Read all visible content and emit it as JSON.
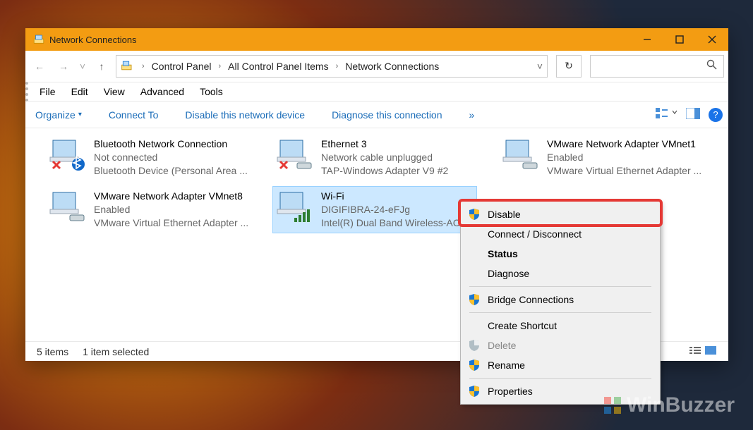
{
  "window": {
    "title": "Network Connections"
  },
  "breadcrumbs": {
    "root": "Control Panel",
    "mid": "All Control Panel Items",
    "leaf": "Network Connections"
  },
  "menubar": {
    "file": "File",
    "edit": "Edit",
    "view": "View",
    "advanced": "Advanced",
    "tools": "Tools"
  },
  "cmdbar": {
    "organize": "Organize",
    "connect_to": "Connect To",
    "disable": "Disable this network device",
    "diagnose": "Diagnose this connection",
    "more": "»"
  },
  "adapters": {
    "bt": {
      "name": "Bluetooth Network Connection",
      "status": "Not connected",
      "desc": "Bluetooth Device (Personal Area ..."
    },
    "eth3": {
      "name": "Ethernet 3",
      "status": "Network cable unplugged",
      "desc": "TAP-Windows Adapter V9 #2"
    },
    "vm1": {
      "name": "VMware Network Adapter VMnet1",
      "status": "Enabled",
      "desc": "VMware Virtual Ethernet Adapter ..."
    },
    "vm8": {
      "name": "VMware Network Adapter VMnet8",
      "status": "Enabled",
      "desc": "VMware Virtual Ethernet Adapter ..."
    },
    "wifi": {
      "name": "Wi-Fi",
      "status": "DIGIFIBRA-24-eFJg",
      "desc": "Intel(R) Dual Band Wireless-AC ..."
    }
  },
  "statusbar": {
    "count": "5 items",
    "selected": "1 item selected"
  },
  "context_menu": {
    "disable": "Disable",
    "connect": "Connect / Disconnect",
    "status": "Status",
    "diagnose": "Diagnose",
    "bridge": "Bridge Connections",
    "shortcut": "Create Shortcut",
    "delete": "Delete",
    "rename": "Rename",
    "properties": "Properties"
  },
  "watermark": "WinBuzzer"
}
